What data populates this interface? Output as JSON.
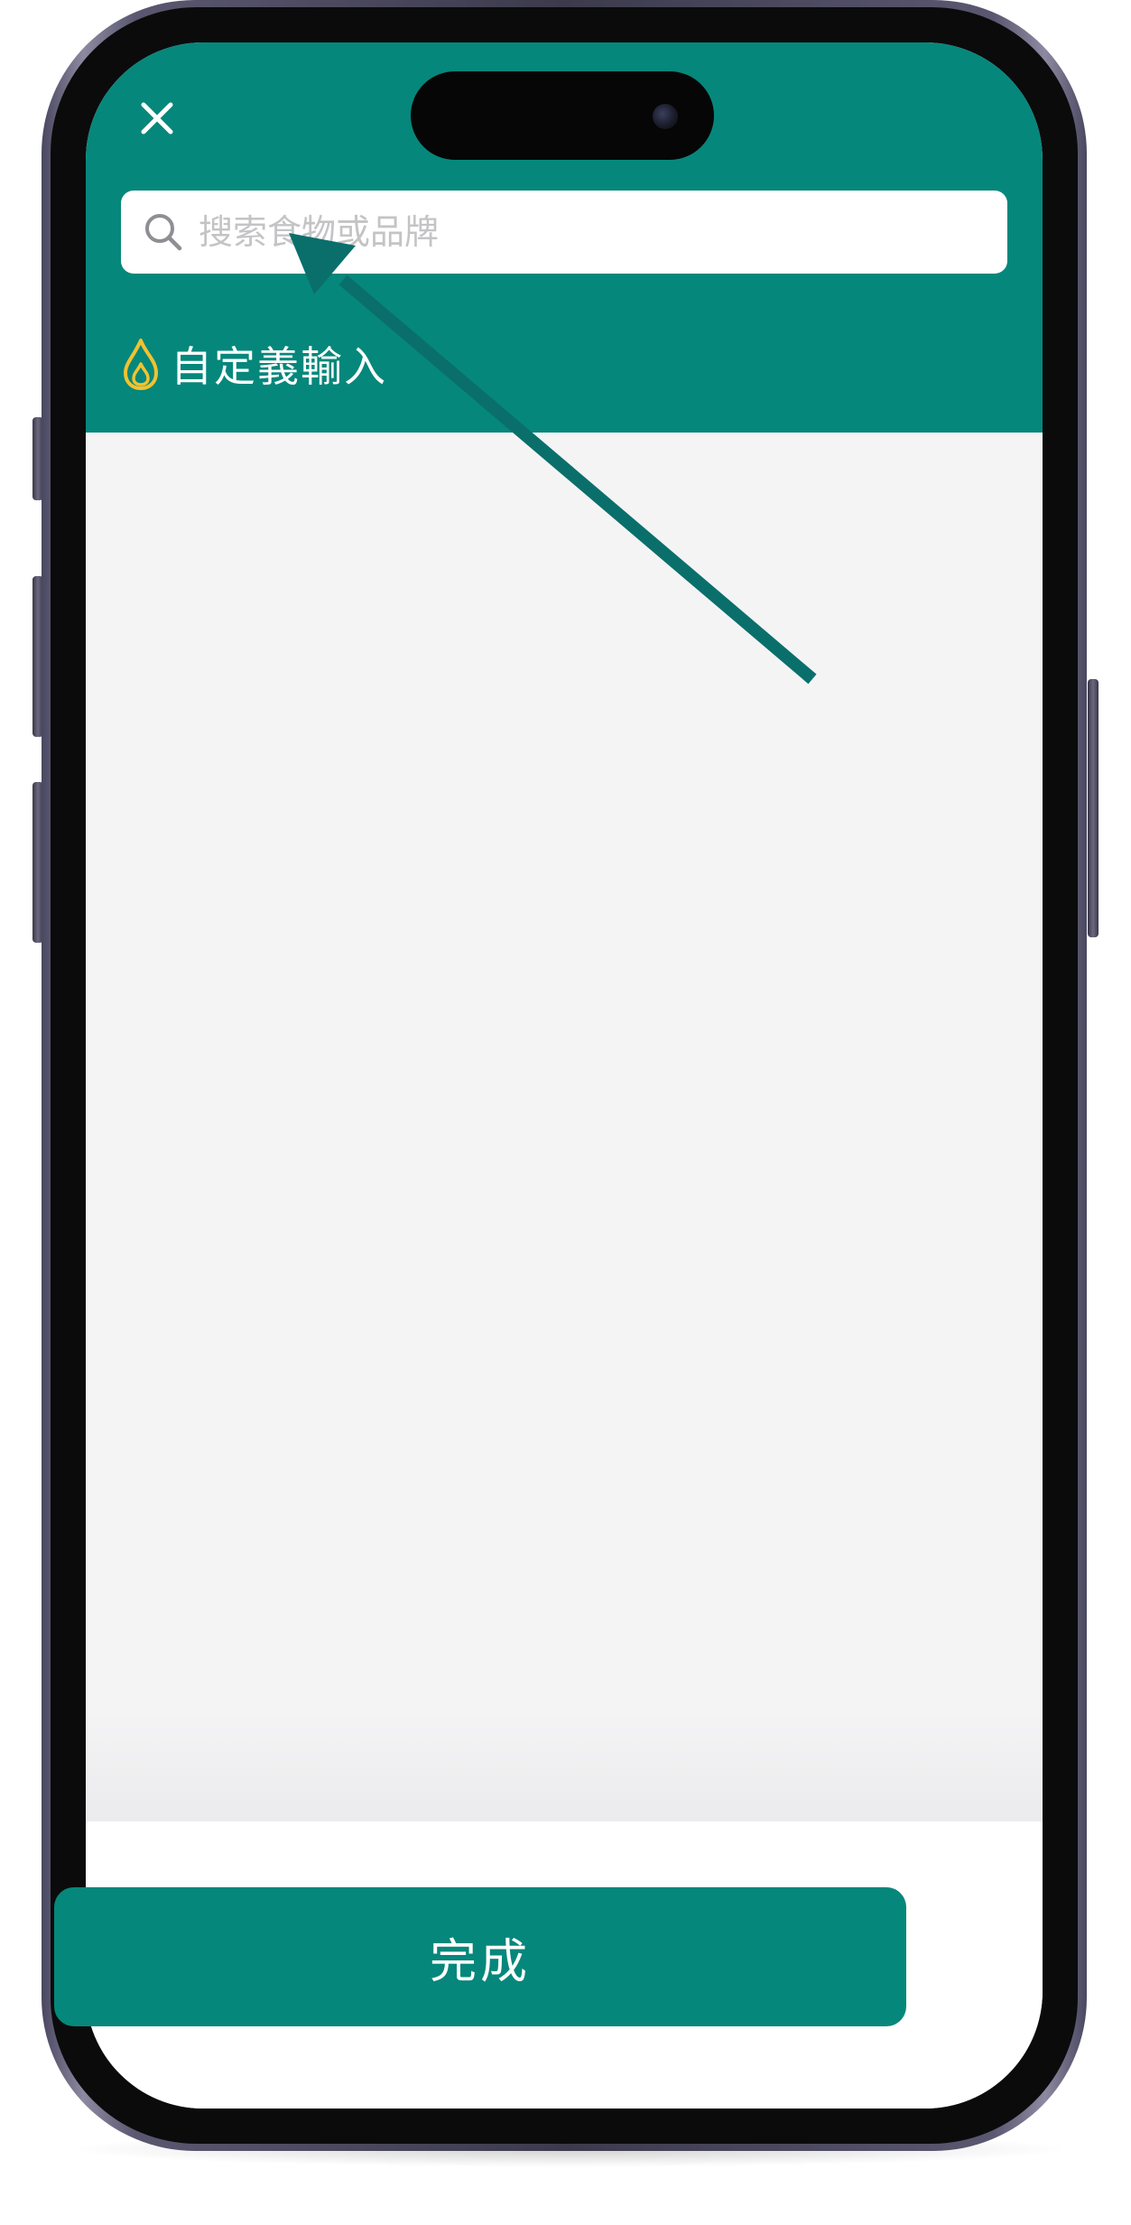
{
  "header": {
    "close_icon": "close-icon",
    "background_color": "#06877b"
  },
  "search": {
    "placeholder": "搜索食物或品牌",
    "value": "",
    "icon": "search-icon"
  },
  "custom_entry": {
    "icon": "flame-icon",
    "label": "自定義輸入",
    "icon_color": "#f2c230"
  },
  "footer": {
    "done_label": "完成",
    "button_color": "#06877b"
  },
  "annotation": {
    "icon": "arrow-icon",
    "color": "#0a6f6b"
  }
}
